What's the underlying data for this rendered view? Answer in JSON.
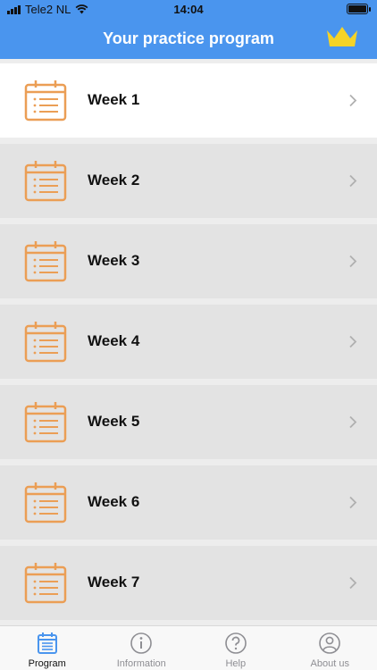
{
  "status_bar": {
    "carrier": "Tele2 NL",
    "time": "14:04"
  },
  "header": {
    "title": "Your practice program",
    "crown_icon": "crown-icon"
  },
  "weeks": [
    {
      "label": "Week 1"
    },
    {
      "label": "Week 2"
    },
    {
      "label": "Week 3"
    },
    {
      "label": "Week 4"
    },
    {
      "label": "Week 5"
    },
    {
      "label": "Week 6"
    },
    {
      "label": "Week 7"
    }
  ],
  "tabs": [
    {
      "label": "Program",
      "icon": "calendar-list-icon"
    },
    {
      "label": "Information",
      "icon": "info-icon"
    },
    {
      "label": "Help",
      "icon": "question-icon"
    },
    {
      "label": "About us",
      "icon": "person-icon"
    }
  ],
  "colors": {
    "header": "#4a95ee",
    "calendar": "#eb9e55",
    "crown": "#f5d327",
    "tab_active": "#4a95ee"
  }
}
